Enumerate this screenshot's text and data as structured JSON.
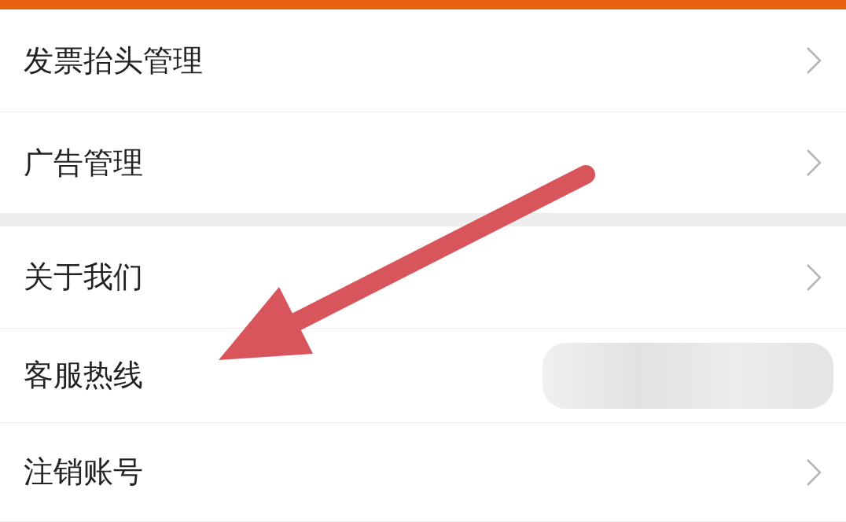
{
  "groups": [
    {
      "items": [
        {
          "label": "发票抬头管理",
          "kind": "link"
        },
        {
          "label": "广告管理",
          "kind": "link"
        }
      ]
    },
    {
      "items": [
        {
          "label": "关于我们",
          "kind": "link"
        },
        {
          "label": "客服热线",
          "kind": "redacted"
        },
        {
          "label": "注销账号",
          "kind": "link"
        }
      ]
    }
  ]
}
